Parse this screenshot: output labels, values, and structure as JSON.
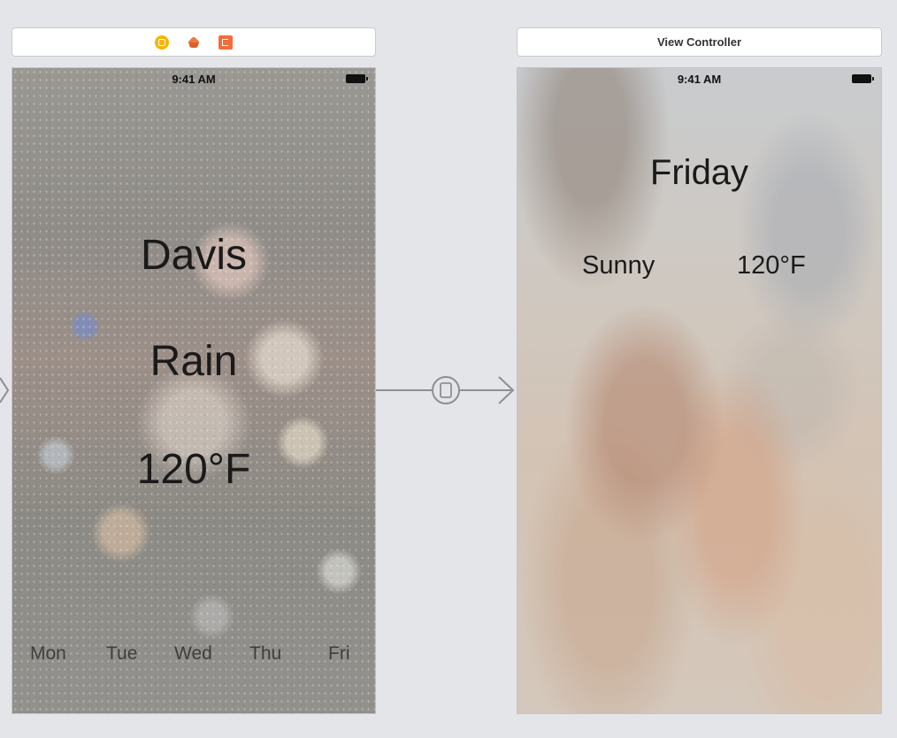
{
  "left_scene": {
    "status_time": "9:41 AM",
    "city": "Davis",
    "condition": "Rain",
    "temperature": "120°F",
    "days": [
      "Mon",
      "Tue",
      "Wed",
      "Thu",
      "Fri"
    ]
  },
  "right_scene": {
    "title": "View Controller",
    "status_time": "9:41 AM",
    "day": "Friday",
    "weather": "Sunny",
    "temperature": "120°F"
  },
  "icons": {
    "left_bar": [
      "view-controller-icon",
      "first-responder-icon",
      "exit-icon"
    ],
    "segue": "segue-icon",
    "status": "battery-icon"
  },
  "colors": {
    "canvas": "#e4e5e8",
    "view_controller_icon": "#f7b500",
    "first_responder_icon": "#ee7a3c",
    "exit_icon": "#f26d3b",
    "segue_line": "#8e8e93"
  }
}
